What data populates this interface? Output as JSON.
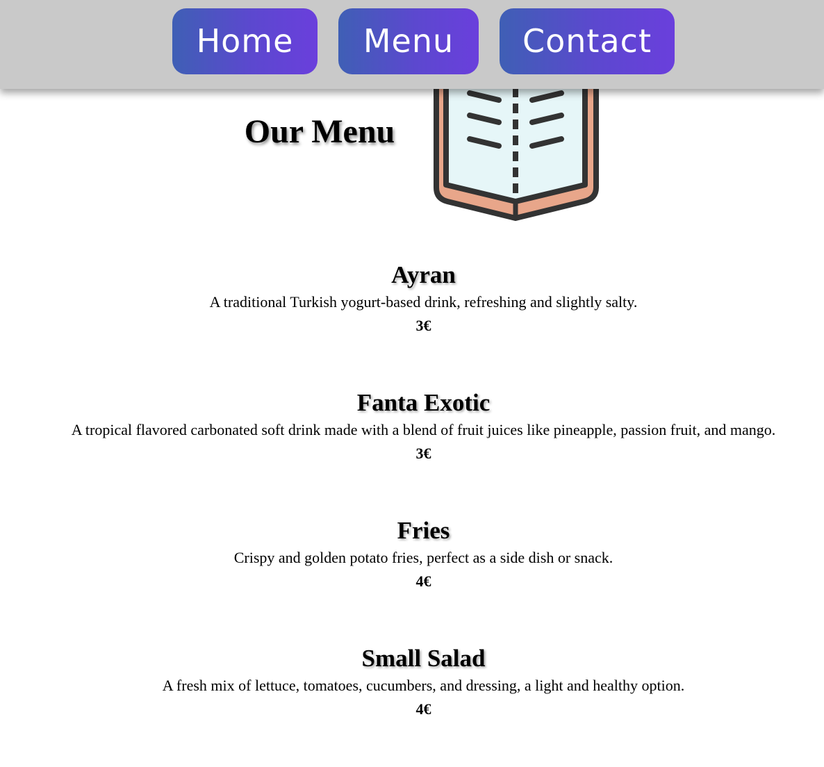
{
  "nav": {
    "home_label": "Home",
    "menu_label": "Menu",
    "contact_label": "Contact"
  },
  "header": {
    "title": "Our Menu",
    "icon": "open-book-icon"
  },
  "menu_items": [
    {
      "name": "Ayran",
      "description": "A traditional Turkish yogurt-based drink, refreshing and slightly salty.",
      "price": "3€"
    },
    {
      "name": "Fanta Exotic",
      "description": "A tropical flavored carbonated soft drink made with a blend of fruit juices like pineapple, passion fruit, and mango.",
      "price": "3€"
    },
    {
      "name": "Fries",
      "description": "Crispy and golden potato fries, perfect as a side dish or snack.",
      "price": "4€"
    },
    {
      "name": "Small Salad",
      "description": "A fresh mix of lettuce, tomatoes, cucumbers, and dressing, a light and healthy option.",
      "price": "4€"
    }
  ],
  "colors": {
    "navbar_bg": "#c9c9c9",
    "button_gradient_start": "#3f5fb5",
    "button_gradient_end": "#6a3fdc",
    "book_cover": "#e8a68a",
    "book_pages": "#e6f6f8",
    "book_outline": "#333333"
  }
}
